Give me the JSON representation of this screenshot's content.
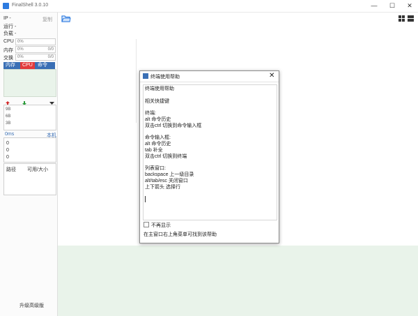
{
  "window": {
    "title": "FinalShell 3.0.10",
    "minimize": "—",
    "maximize": "☐",
    "close": "✕"
  },
  "sidebar": {
    "ip_label": "IP -",
    "copy_label": "复制",
    "uptime_label": "运行 -",
    "load_label": "负载 -",
    "cpu": {
      "label": "CPU",
      "value": "0%"
    },
    "mem": {
      "label": "内存",
      "value": "0%",
      "detail": "0/0"
    },
    "swap": {
      "label": "交换",
      "value": "0%",
      "detail": "0/0"
    },
    "tabs": [
      "内存",
      "CPU",
      "命令"
    ],
    "net": {
      "scale": [
        "9B",
        "6B",
        "3B"
      ]
    },
    "ping": {
      "latency": "0ms",
      "host": "本机",
      "rows": [
        "0",
        "0",
        "0"
      ]
    },
    "disk": {
      "col_path": "路径",
      "col_size": "可用/大小"
    },
    "upgrade_label": "升级高级版"
  },
  "toolbar": {
    "folder_icon": "folder-icon",
    "view_icon": "grid-view-icon"
  },
  "dialog": {
    "title": "终端使用帮助",
    "lines": [
      "终端使用帮助",
      "",
      "相关快捷键",
      "",
      "终端:",
      "alt 命令历史",
      "双击ctrl 切换到命令输入框",
      "",
      "命令输入框:",
      "alt 命令历史",
      "tab 补全",
      "双击ctrl 切换到终端",
      "",
      "列表窗口:",
      "backspace 上一级目录",
      "alt/tab/esc 关闭窗口",
      "上下箭头 选择行"
    ],
    "dont_show_label": "不再显示",
    "footer": "在主窗口右上角菜单可找到该帮助"
  },
  "colors": {
    "accent": "#3a6fb5",
    "cpu_tab": "#e23b3b",
    "up_arrow": "#d32b2b",
    "down_arrow": "#2b9b3b",
    "panel_green": "#e9f3ea"
  }
}
